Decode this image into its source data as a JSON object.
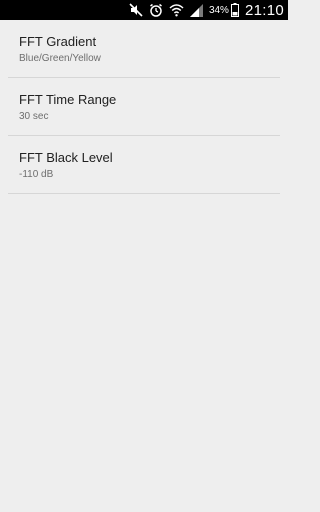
{
  "status_bar": {
    "battery_percent": "34%",
    "time": "21:10",
    "icons": [
      "mute-icon",
      "alarm-icon",
      "wifi-icon",
      "signal-icon",
      "battery-icon"
    ]
  },
  "preferences": [
    {
      "title": "FFT Gradient",
      "summary": "Blue/Green/Yellow"
    },
    {
      "title": "FFT Time Range",
      "summary": "30 sec"
    },
    {
      "title": "FFT Black Level",
      "summary": "-110 dB"
    }
  ],
  "colors": {
    "background": "#eeeeee",
    "status_bar": "#000000",
    "title_text": "#212121",
    "summary_text": "#6e6e6e",
    "divider": "#d6d6d6"
  }
}
